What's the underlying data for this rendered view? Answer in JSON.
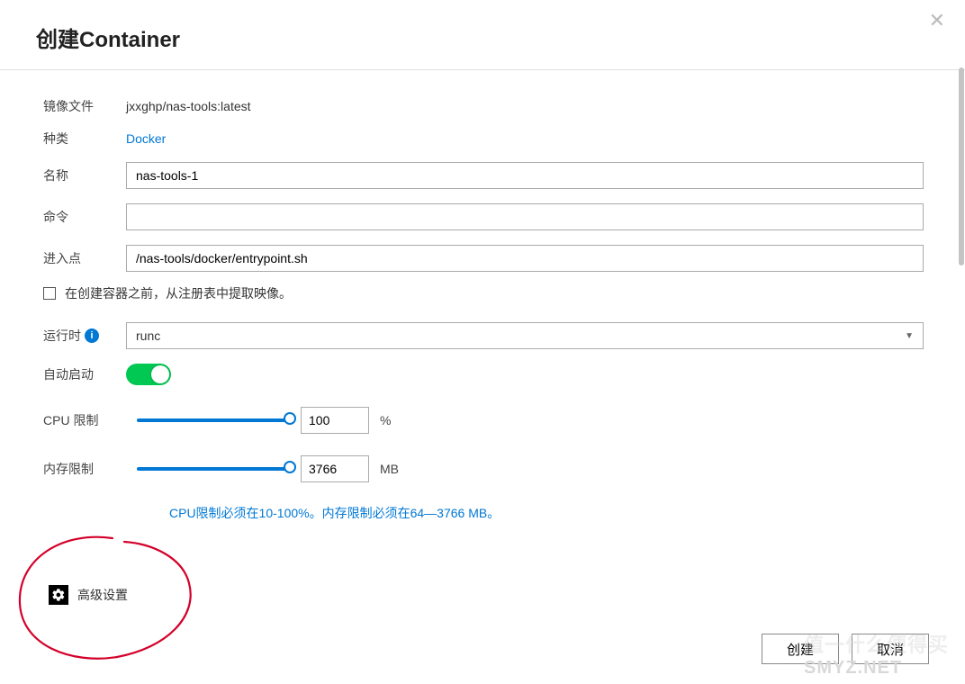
{
  "dialog": {
    "title": "创建Container"
  },
  "form": {
    "image_label": "镜像文件",
    "image_value": "jxxghp/nas-tools:latest",
    "type_label": "种类",
    "type_value": "Docker",
    "name_label": "名称",
    "name_value": "nas-tools-1",
    "command_label": "命令",
    "command_value": "",
    "entry_label": "进入点",
    "entry_value": "/nas-tools/docker/entrypoint.sh",
    "pull_checkbox_label": "在创建容器之前，从注册表中提取映像。",
    "runtime_label": "运行时",
    "runtime_value": "runc",
    "autostart_label": "自动启动",
    "autostart_on": true,
    "cpu_label": "CPU 限制",
    "cpu_value": "100",
    "cpu_unit": "%",
    "mem_label": "内存限制",
    "mem_value": "3766",
    "mem_unit": "MB",
    "limits_hint": "CPU限制必须在10-100%。内存限制必须在64—3766 MB。",
    "advanced_label": "高级设置"
  },
  "buttons": {
    "create": "创建",
    "cancel": "取消"
  },
  "watermark": {
    "faint": "值一什么便得买",
    "main": "SMYZ.NET"
  }
}
